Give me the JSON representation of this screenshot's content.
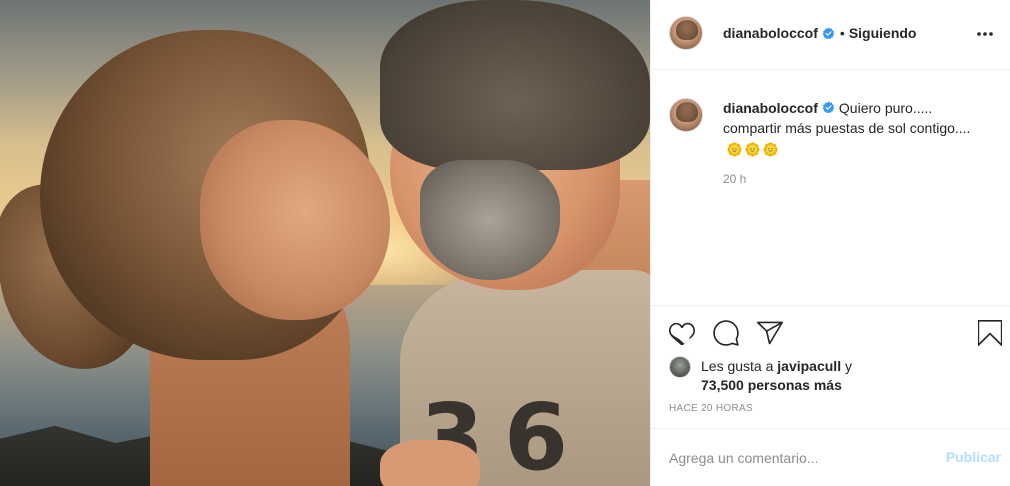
{
  "post": {
    "username": "dianabolocc​of",
    "follow_status": "Siguiendo",
    "separator": "•",
    "caption_line": "Quiero puro..... compartir más puestas de sol contigo....",
    "caption_time": "20 h",
    "likes_prefix": "Les gusta a",
    "liker": "javipacull",
    "likes_and": "y",
    "likes_count": "73,500 personas más",
    "post_age": "HACE 20 HORAS",
    "tshirt_print": "3 6 0"
  },
  "comment": {
    "placeholder": "Agrega un comentario...",
    "publish_label": "Publicar"
  },
  "icons": {
    "verified": "verified-badge-icon",
    "more": "more-options-icon",
    "like": "heart-icon",
    "comment": "comment-bubble-icon",
    "share": "paper-plane-icon",
    "save": "bookmark-icon",
    "emoji": "sun-face-emoji"
  },
  "colors": {
    "verified_blue": "#3897f0",
    "publish_disabled": "#b2dffc",
    "muted_text": "#8e8e8e",
    "text": "#262626",
    "border": "#efefef"
  }
}
